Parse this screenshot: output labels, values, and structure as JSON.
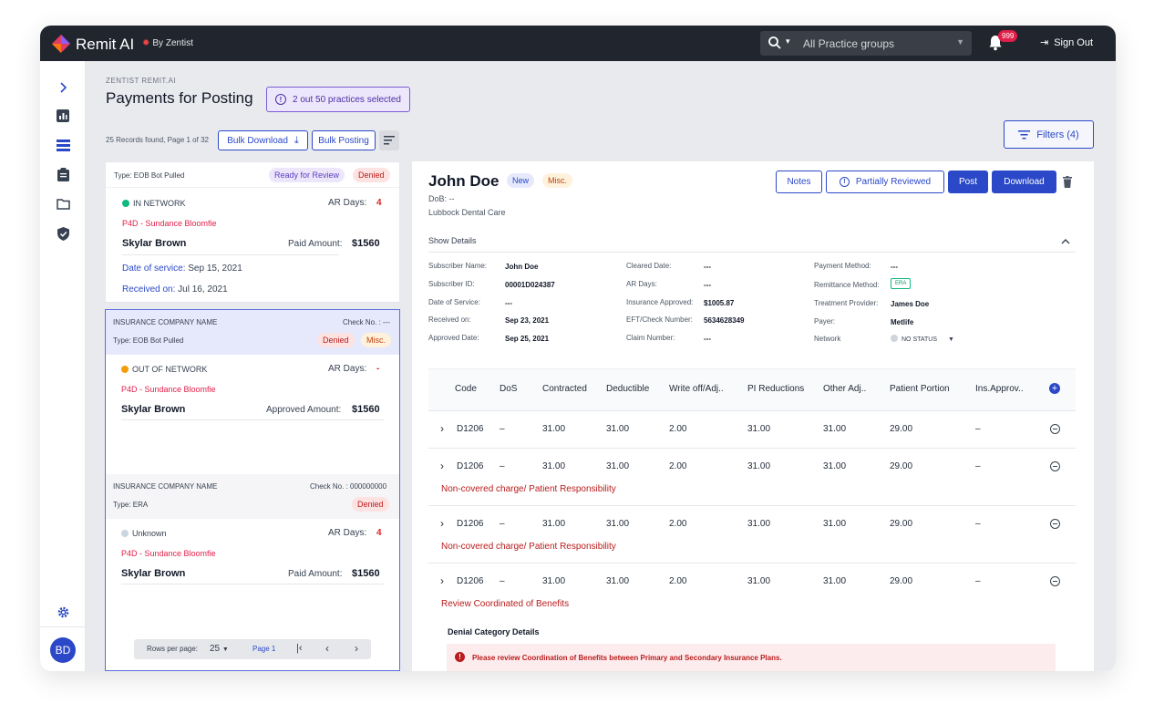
{
  "app": {
    "brand": "Remit AI",
    "by": "By Zentist"
  },
  "topbar": {
    "search_caret": "▾",
    "practice_groups": "All Practice groups",
    "notifications": "999",
    "sign_out": "Sign Out"
  },
  "sidebar": {
    "avatar": "BD"
  },
  "page": {
    "breadcrumb": "ZENTIST REMIT.AI",
    "title": "Payments for Posting",
    "practices_selected": "2 out 50 practices selected",
    "records": "25 Records found, Page 1 of 32",
    "bulk_download": "Bulk Download",
    "bulk_posting": "Bulk Posting",
    "filters": "Filters (4)"
  },
  "cards": [
    {
      "type": "Type: EOB Bot Pulled",
      "chips": [
        "Ready for Review",
        "Denied"
      ],
      "network": "IN NETWORK",
      "ar_label": "AR Days:",
      "ar_value": "4",
      "practice": "P4D - Sundance Bloomfie",
      "patient": "Skylar Brown",
      "amount_label": "Paid Amount:",
      "amount": "$1560",
      "dos_label": "Date of service:",
      "dos": "Sep 15, 2021",
      "received_label": "Received on:",
      "received": "Jul 16, 2021"
    },
    {
      "company": "INSURANCE COMPANY NAME",
      "check": "Check No. : ---",
      "type": "Type: EOB Bot Pulled",
      "chips": [
        "Denied",
        "Misc."
      ],
      "network": "OUT OF NETWORK",
      "ar_label": "AR Days:",
      "ar_value": "-",
      "practice": "P4D - Sundance Bloomfie",
      "patient": "Skylar Brown",
      "amount_label": "Approved Amount:",
      "amount": "$1560"
    },
    {
      "company": "INSURANCE COMPANY NAME",
      "check": "Check No. : 000000000",
      "type": "Type: ERA",
      "chips": [
        "Denied"
      ],
      "network": "Unknown",
      "ar_label": "AR Days:",
      "ar_value": "4",
      "practice": "P4D - Sundance Bloomfie",
      "patient": "Skylar Brown",
      "amount_label": "Paid Amount:",
      "amount": "$1560"
    }
  ],
  "pagination": {
    "rows_label": "Rows per page:",
    "rows": "25",
    "page": "Page 1"
  },
  "detail": {
    "name": "John Doe",
    "chip_new": "New",
    "chip_misc": "Misc.",
    "dob": "DoB: --",
    "practice": "Lubbock Dental Care",
    "buttons": {
      "notes": "Notes",
      "partially": "Partially Reviewed",
      "post": "Post",
      "download": "Download"
    },
    "show_details": "Show Details",
    "fields": [
      {
        "label": "Subscriber Name:",
        "value": "John Doe"
      },
      {
        "label": "Subscriber ID:",
        "value": "00001D024387"
      },
      {
        "label": "Date of Service:",
        "value": "---"
      },
      {
        "label": "Received on:",
        "value": "Sep 23, 2021"
      },
      {
        "label": "Approved Date:",
        "value": "Sep 25, 2021"
      },
      {
        "label": "Cleared Date:",
        "value": "---"
      },
      {
        "label": "AR Days:",
        "value": "---"
      },
      {
        "label": "Insurance Approved:",
        "value": "$1005.87"
      },
      {
        "label": "EFT/Check Number:",
        "value": "5634628349"
      },
      {
        "label": "Claim Number:",
        "value": "---"
      },
      {
        "label": "Payment Method:",
        "value": "---"
      },
      {
        "label": "Remittance Method:",
        "value": "ERA"
      },
      {
        "label": "Treatment Provider:",
        "value": "James Doe"
      },
      {
        "label": "Payer:",
        "value": "Metlife"
      },
      {
        "label": "Network",
        "value": "NO STATUS"
      }
    ],
    "columns": [
      "Code",
      "DoS",
      "Contracted",
      "Deductible",
      "Write off/Adj..",
      "PI Reductions",
      "Other Adj..",
      "Patient Portion",
      "Ins.Approv.."
    ],
    "rows": [
      {
        "cells": [
          "D1206",
          "–",
          "31.00",
          "31.00",
          "2.00",
          "31.00",
          "31.00",
          "29.00",
          "–"
        ],
        "note": ""
      },
      {
        "cells": [
          "D1206",
          "–",
          "31.00",
          "31.00",
          "2.00",
          "31.00",
          "31.00",
          "29.00",
          "–"
        ],
        "note": "Non-covered charge/ Patient Responsibility"
      },
      {
        "cells": [
          "D1206",
          "–",
          "31.00",
          "31.00",
          "2.00",
          "31.00",
          "31.00",
          "29.00",
          "–"
        ],
        "note": "Non-covered charge/ Patient Responsibility"
      },
      {
        "cells": [
          "D1206",
          "–",
          "31.00",
          "31.00",
          "2.00",
          "31.00",
          "31.00",
          "29.00",
          "–"
        ],
        "note": "Review Coordinated of Benefits"
      }
    ],
    "denial_title": "Denial Category Details",
    "denial_msg": "Please review Coordination of Benefits between Primary and Secondary Insurance Plans."
  },
  "colors": {
    "primary": "#2b48c8",
    "topbar": "#21262e",
    "danger": "#b91c1c"
  }
}
